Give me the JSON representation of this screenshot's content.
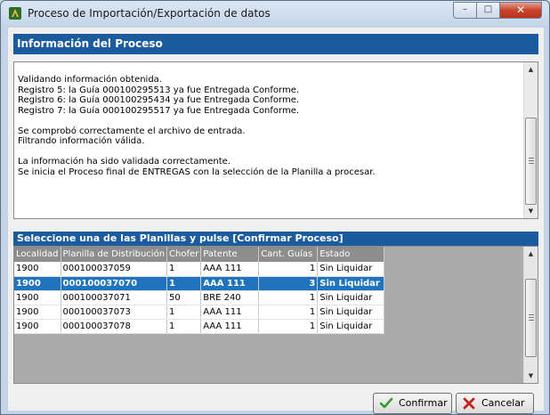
{
  "window": {
    "title": "Proceso de Importación/Exportación de datos",
    "minimize_glyph": "–",
    "maximize_glyph": "□",
    "close_glyph": "✕"
  },
  "process_section": {
    "header": "Información del Proceso",
    "log_lines": [
      "Validando información obtenida.",
      "Registro 5: la Guía 000100295513 ya fue Entregada Conforme.",
      "Registro 6: la Guía 000100295434 ya fue Entregada Conforme.",
      "Registro 7: la Guía 000100295517 ya fue Entregada Conforme.",
      "",
      "Se comprobó correctamente el archivo de entrada.",
      "Filtrando información válida.",
      "",
      "La información ha sido validada correctamente.",
      "Se inicia el Proceso final de ENTREGAS con la selección de la Planilla a procesar."
    ]
  },
  "planillas_section": {
    "header": "Seleccione una de las Planillas y pulse [Confirmar Proceso]",
    "columns": [
      "Localidad",
      "Planilla de Distribución",
      "Chofer",
      "Patente",
      "Cant. Guías",
      "Estado"
    ],
    "rows": [
      [
        "1900",
        "000100037059",
        "1",
        "AAA 111",
        "1",
        "Sin Liquidar"
      ],
      [
        "1900",
        "000100037070",
        "1",
        "AAA 111",
        "3",
        "Sin Liquidar"
      ],
      [
        "1900",
        "000100037071",
        "50",
        "BRE 240",
        "1",
        "Sin Liquidar"
      ],
      [
        "1900",
        "000100037073",
        "1",
        "AAA 111",
        "1",
        "Sin Liquidar"
      ],
      [
        "1900",
        "000100037078",
        "1",
        "AAA 111",
        "1",
        "Sin Liquidar"
      ]
    ],
    "selected_row": 1
  },
  "buttons": {
    "confirm_label": "Confirmar",
    "cancel_label": "Cancelar"
  },
  "colors": {
    "section_header": "#1b5c9e",
    "selected_row": "#1f74bd",
    "grid_header": "#8d8d8d",
    "close_button": "#c7442b"
  },
  "icons": {
    "app": "app-logo-icon",
    "confirm": "check-icon",
    "cancel": "x-icon"
  }
}
